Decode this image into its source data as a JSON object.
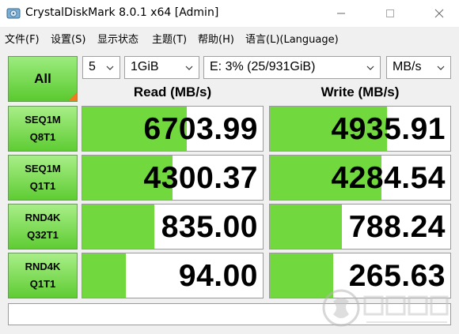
{
  "window": {
    "title": "CrystalDiskMark 8.0.1 x64 [Admin]"
  },
  "menu": [
    "文件(F)",
    "设置(S)",
    "显示状态",
    "主题(T)",
    "帮助(H)",
    "语言(L)(Language)"
  ],
  "controls": {
    "all_label": "All",
    "count": "5",
    "size": "1GiB",
    "drive": "E: 3% (25/931GiB)",
    "unit": "MB/s"
  },
  "columns": {
    "read": "Read (MB/s)",
    "write": "Write (MB/s)"
  },
  "rows": [
    {
      "line1": "SEQ1M",
      "line2": "Q8T1",
      "read": "6703.99",
      "write": "4935.91",
      "read_fill": 0.58,
      "write_fill": 0.65
    },
    {
      "line1": "SEQ1M",
      "line2": "Q1T1",
      "read": "4300.37",
      "write": "4284.54",
      "read_fill": 0.5,
      "write_fill": 0.62
    },
    {
      "line1": "RND4K",
      "line2": "Q32T1",
      "read": "835.00",
      "write": "788.24",
      "read_fill": 0.4,
      "write_fill": 0.4
    },
    {
      "line1": "RND4K",
      "line2": "Q1T1",
      "read": "94.00",
      "write": "265.63",
      "read_fill": 0.24,
      "write_fill": 0.35
    }
  ],
  "comment": "",
  "colors": {
    "bar": "#71d93d",
    "label_bg": "#5fcc33",
    "corner": "#f07b1c"
  },
  "icons": {
    "app": "disk-icon",
    "minimize": "minimize-icon",
    "maximize": "maximize-icon",
    "close": "close-icon",
    "dropdown": "chevron-down-icon"
  }
}
